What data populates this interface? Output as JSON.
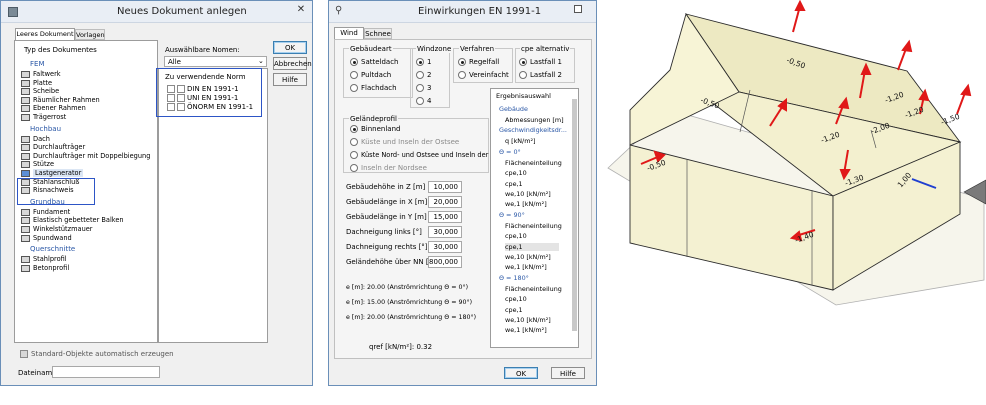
{
  "left_window": {
    "title": "Neues Dokument anlegen",
    "tabs": [
      "Leeres Dokument",
      "Vorlagen"
    ],
    "type_header": "Typ des Dokumentes",
    "groups": [
      {
        "name": "FEM",
        "items": [
          "Faltwerk",
          "Platte",
          "Scheibe",
          "Räumlicher Rahmen",
          "Ebener Rahmen",
          "Trägerrost"
        ]
      },
      {
        "name": "Hochbau",
        "items": [
          "Dach",
          "Durchlaufträger",
          "Durchlaufträger mit Doppelbiegung",
          "Stütze",
          "Lastgenerator",
          "Stahlanschluß",
          "Risnachweis"
        ]
      },
      {
        "name": "Grundbau",
        "items": [
          "Fundament",
          "Elastisch gebetteter Balken",
          "Winkelstützmauer",
          "Spundwand"
        ]
      },
      {
        "name": "Querschnitte",
        "items": [
          "Stahlprofil",
          "Betonprofil"
        ]
      }
    ],
    "norms_label": "Auswählbare Nomen:",
    "norms_select": "Alle",
    "norm_header": "Zu verwendende Norm",
    "norm_items": [
      "DIN EN 1991-1",
      "UNI EN 1991-1",
      "ÖNORM EN 1991-1"
    ],
    "buttons": {
      "ok": "OK",
      "cancel": "Abbrechen",
      "help": "Hilfe"
    },
    "std_objects": "Standard-Objekte automatisch erzeugen",
    "filename_label": "Dateiname:",
    "filename_value": ""
  },
  "mid_window": {
    "title": "Einwirkungen EN 1991-1",
    "tabs": [
      "Wind",
      "Schnee"
    ],
    "gebaeudeart": {
      "title": "Gebäudeart",
      "options": [
        "Satteldach",
        "Pultdach",
        "Flachdach"
      ],
      "selected": 0
    },
    "windzone": {
      "title": "Windzone",
      "options": [
        "1",
        "2",
        "3",
        "4"
      ],
      "selected": 0
    },
    "verfahren": {
      "title": "Verfahren",
      "options": [
        "Regelfall",
        "Vereinfacht"
      ],
      "selected": 0
    },
    "cpe": {
      "title": "cpe alternativ",
      "options": [
        "Lastfall 1",
        "Lastfall 2"
      ],
      "selected": 0
    },
    "gelaendeprofil": {
      "title": "Geländeprofil",
      "options": [
        "Binnenland",
        "Küste und Inseln der Ostsee",
        "Küste Nord- und Ostsee und Inseln der Ostsee",
        "Inseln der Nordsee"
      ],
      "selected": 0
    },
    "fields": [
      {
        "label": "Gebäudehöhe in Z [m]",
        "value": "10,000"
      },
      {
        "label": "Gebäudelänge in X [m]",
        "value": "20,000"
      },
      {
        "label": "Gebäudelänge in Y [m]",
        "value": "15,000"
      },
      {
        "label": "Dachneigung links [°]",
        "value": "30,000"
      },
      {
        "label": "Dachneigung rechts [°]",
        "value": "30,000"
      },
      {
        "label": "Geländehöhe über NN [m]",
        "value": "800,000"
      }
    ],
    "e_lines": [
      "e [m]: 20.00  (Anströmrichtung Θ = 0°)",
      "e [m]: 15.00  (Anströmrichtung Θ = 90°)",
      "e [m]: 20.00  (Anströmrichtung Θ = 180°)"
    ],
    "qref": "qref [kN/m²]: 0.32",
    "results": {
      "title": "Ergebnisauswahl",
      "rows": [
        {
          "t": "Gebäude",
          "h": true
        },
        {
          "t": "Abmessungen [m]",
          "h": false
        },
        {
          "t": "Geschwindigkeitsdr...",
          "h": true
        },
        {
          "t": "q [kN/m²]",
          "h": false
        },
        {
          "t": "Θ = 0°",
          "h": true
        },
        {
          "t": "Flächeneinteilung",
          "h": false
        },
        {
          "t": "cpe,10",
          "h": false
        },
        {
          "t": "cpe,1",
          "h": false
        },
        {
          "t": "we,10 [kN/m²]",
          "h": false
        },
        {
          "t": "we,1 [kN/m²]",
          "h": false
        },
        {
          "t": "Θ = 90°",
          "h": true
        },
        {
          "t": "Flächeneinteilung",
          "h": false
        },
        {
          "t": "cpe,10",
          "h": false
        },
        {
          "t": "cpe,1",
          "h": false
        },
        {
          "t": "we,10 [kN/m²]",
          "h": false
        },
        {
          "t": "we,1 [kN/m²]",
          "h": false
        },
        {
          "t": "Θ = 180°",
          "h": true
        },
        {
          "t": "Flächeneinteilung",
          "h": false
        },
        {
          "t": "cpe,10",
          "h": false
        },
        {
          "t": "cpe,1",
          "h": false
        },
        {
          "t": "we,10 [kN/m²]",
          "h": false
        },
        {
          "t": "we,1 [kN/m²]",
          "h": false
        }
      ]
    },
    "buttons": {
      "ok": "OK",
      "help": "Hilfe"
    }
  },
  "model": {
    "labels": [
      "-0,50",
      "-0,50",
      "-1,20",
      "-1,20",
      "-2,00",
      "-1,50",
      "-1,20",
      "-1,30",
      "-0,50",
      "-1,40",
      "1,00"
    ],
    "colors": {
      "face": "#f5f3d8",
      "edge": "#2b2b2b",
      "arrow": "#e01818",
      "axis": "#1f3fd0"
    }
  }
}
